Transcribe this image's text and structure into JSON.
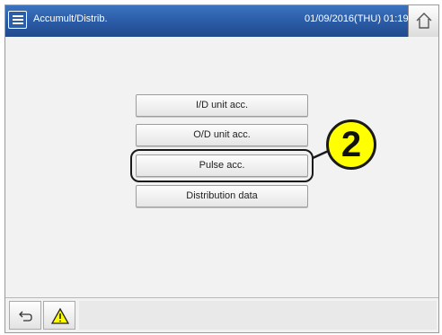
{
  "header": {
    "menu_icon": "list-menu-icon",
    "title": "Accumult/Distrib.",
    "datetime": "01/09/2016(THU) 01:19",
    "home_icon": "home-icon"
  },
  "menu": {
    "buttons": [
      {
        "label": "I/D unit acc."
      },
      {
        "label": "O/D unit acc."
      },
      {
        "label": "Pulse acc."
      },
      {
        "label": "Distribution data"
      }
    ]
  },
  "callout": {
    "number": "2",
    "color": "#ffff00"
  },
  "footer": {
    "back_icon": "return-arrow-icon",
    "warning_icon": "warning-triangle-icon"
  },
  "colors": {
    "header_blue": "#2a5aa4"
  }
}
